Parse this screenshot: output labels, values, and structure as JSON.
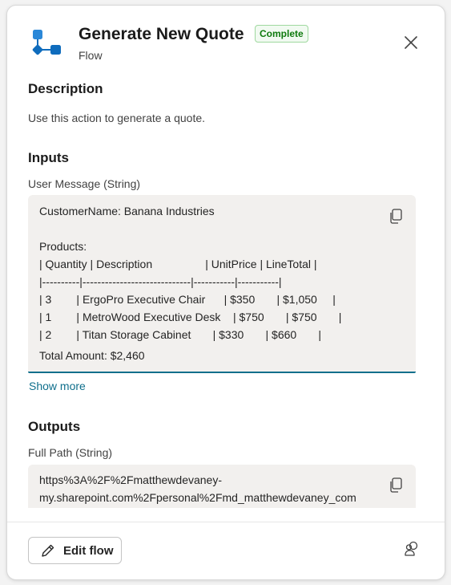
{
  "header": {
    "title": "Generate New Quote",
    "status_badge": "Complete",
    "subtitle": "Flow",
    "icon": "flow-icon",
    "close_icon": "close-icon"
  },
  "description": {
    "heading": "Description",
    "text": "Use this action to generate a quote."
  },
  "inputs": {
    "heading": "Inputs",
    "field_label": "User Message (String)",
    "lines": [
      "CustomerName: Banana Industries",
      "",
      "Products:",
      "| Quantity | Description                 | UnitPrice | LineTotal |",
      "|----------|-----------------------------|-----------|-----------|",
      "| 3        | ErgoPro Executive Chair      | $350       | $1,050     |",
      "| 1        | MetroWood Executive Desk    | $750       | $750       |",
      "| 2        | Titan Storage Cabinet       | $330       | $660       |",
      "Total Amount: $2,460"
    ],
    "show_more": "Show more",
    "copy_icon": "copy-icon"
  },
  "outputs": {
    "heading": "Outputs",
    "field_label": "Full Path (String)",
    "lines": [
      "https%3A%2F%2Fmatthewdevaney-",
      "my.sharepoint.com%2Fpersonal%2Fmd_matthewdevaney_com"
    ],
    "copy_icon": "copy-icon"
  },
  "footer": {
    "edit_button_label": "Edit flow",
    "edit_icon": "pencil-icon",
    "feedback_icon": "feedback-icon"
  },
  "colors": {
    "accent": "#0f6f8c",
    "badge_green": "#0e7a0d",
    "flow_icon_blue": "#0f7ad6"
  }
}
